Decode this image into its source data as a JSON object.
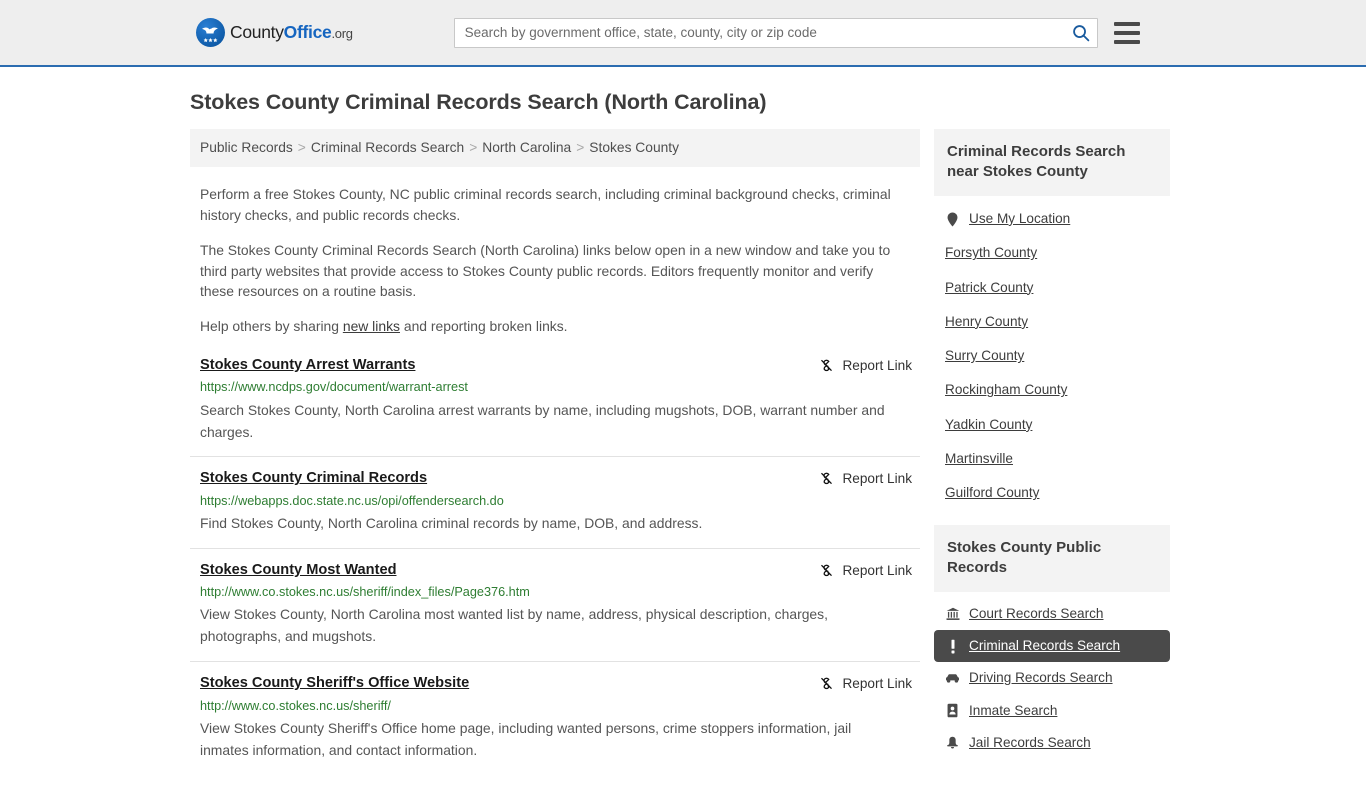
{
  "header": {
    "logo": {
      "text_county": "County",
      "text_office": "Office",
      "text_org": ".org",
      "icon": "eagle-shield-icon"
    },
    "search": {
      "placeholder": "Search by government office, state, county, city or zip code",
      "value": "",
      "button_icon": "search-icon"
    },
    "menu_icon": "hamburger-menu-icon"
  },
  "page": {
    "title": "Stokes County Criminal Records Search (North Carolina)"
  },
  "breadcrumb": {
    "items": [
      {
        "label": "Public Records"
      },
      {
        "label": "Criminal Records Search"
      },
      {
        "label": "North Carolina"
      },
      {
        "label": "Stokes County"
      }
    ],
    "separator": ">"
  },
  "intro": {
    "paragraph1": "Perform a free Stokes County, NC public criminal records search, including criminal background checks, criminal history checks, and public records checks.",
    "paragraph2": "The Stokes County Criminal Records Search (North Carolina) links below open in a new window and take you to third party websites that provide access to Stokes County public records. Editors frequently monitor and verify these resources on a routine basis.",
    "paragraph3_before": "Help others by sharing ",
    "paragraph3_link": "new links",
    "paragraph3_after": " and reporting broken links."
  },
  "results": {
    "report_label": "Report Link",
    "report_icon": "broken-link-icon",
    "items": [
      {
        "title": "Stokes County Arrest Warrants",
        "url": "https://www.ncdps.gov/document/warrant-arrest",
        "description": "Search Stokes County, North Carolina arrest warrants by name, including mugshots, DOB, warrant number and charges."
      },
      {
        "title": "Stokes County Criminal Records",
        "url": "https://webapps.doc.state.nc.us/opi/offendersearch.do",
        "description": "Find Stokes County, North Carolina criminal records by name, DOB, and address."
      },
      {
        "title": "Stokes County Most Wanted",
        "url": "http://www.co.stokes.nc.us/sheriff/index_files/Page376.htm",
        "description": "View Stokes County, North Carolina most wanted list by name, address, physical description, charges, photographs, and mugshots."
      },
      {
        "title": "Stokes County Sheriff's Office Website",
        "url": "http://www.co.stokes.nc.us/sheriff/",
        "description": "View Stokes County Sheriff's Office home page, including wanted persons, crime stoppers information, jail inmates information, and contact information."
      }
    ]
  },
  "sidebar": {
    "nearby": {
      "heading": "Criminal Records Search near Stokes County",
      "items": [
        {
          "label": "Use My Location",
          "icon": "map-pin-icon"
        },
        {
          "label": "Forsyth County",
          "icon": ""
        },
        {
          "label": "Patrick County",
          "icon": ""
        },
        {
          "label": "Henry County",
          "icon": ""
        },
        {
          "label": "Surry County",
          "icon": ""
        },
        {
          "label": "Rockingham County",
          "icon": ""
        },
        {
          "label": "Yadkin County",
          "icon": ""
        },
        {
          "label": "Martinsville",
          "icon": ""
        },
        {
          "label": "Guilford County",
          "icon": ""
        }
      ]
    },
    "public_records": {
      "heading": "Stokes County Public Records",
      "items": [
        {
          "label": "Court Records Search",
          "icon": "courthouse-icon",
          "active": false
        },
        {
          "label": "Criminal Records Search",
          "icon": "exclamation-icon",
          "active": true
        },
        {
          "label": "Driving Records Search",
          "icon": "car-icon",
          "active": false
        },
        {
          "label": "Inmate Search",
          "icon": "id-badge-icon",
          "active": false
        },
        {
          "label": "Jail Records Search",
          "icon": "bell-icon",
          "active": false
        }
      ]
    }
  },
  "colors": {
    "header_bg": "#eeeeee",
    "header_border": "#2b6cb0",
    "brand_blue": "#1565c0",
    "url_green": "#2e7d32",
    "panel_gray": "#f3f3f3",
    "active_dark": "#4a4a4a",
    "text_gray": "#555555"
  }
}
